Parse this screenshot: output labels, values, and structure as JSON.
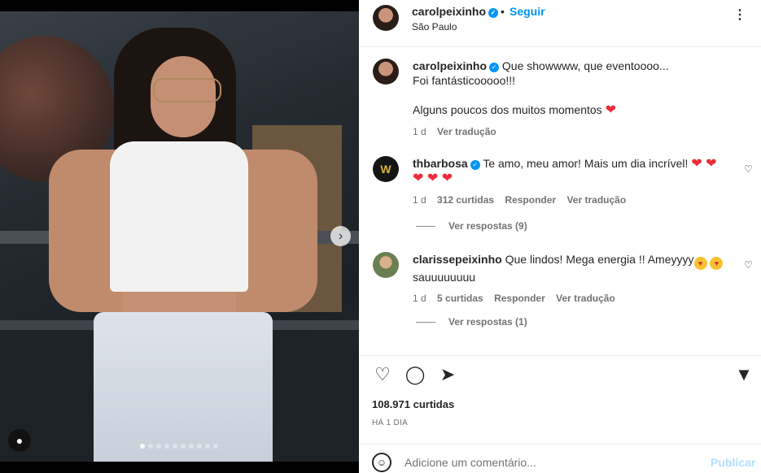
{
  "post": {
    "media": {
      "next_icon": "chevron-right-icon",
      "tag_icon": "user-tag-icon",
      "carousel_count": 10,
      "carousel_active": 0
    },
    "header": {
      "username": "carolpeixinho",
      "verified_icon": "verified-badge-icon",
      "separator": "•",
      "follow_label": "Seguir",
      "location": "São Paulo",
      "more_icon": "more-options-icon",
      "more_label": "⋮"
    },
    "caption": {
      "username": "carolpeixinho",
      "line1": "Que showwww, que eventoooo...",
      "line2": "Foi fantásticooooo!!!",
      "line3": "Alguns poucos dos muitos momentos",
      "heart": "❤",
      "time": "1 d",
      "translate": "Ver tradução"
    },
    "comments": [
      {
        "username": "thbarbosa",
        "verified": true,
        "text": "Te amo, meu amor! Mais um dia incrível!",
        "hearts_inline": "❤ ❤",
        "hearts_line2": "❤ ❤ ❤",
        "time": "1 d",
        "likes": "312 curtidas",
        "reply": "Responder",
        "translate": "Ver tradução",
        "view_replies": "Ver respostas (9)"
      },
      {
        "username": "clarissepeixinho",
        "verified": false,
        "text": "Que lindos! Mega energia !! Ameyyyy",
        "text_line2": "sauuuuuuuu",
        "emoji": "😍",
        "time": "1 d",
        "likes": "5 curtidas",
        "reply": "Responder",
        "translate": "Ver tradução",
        "view_replies": "Ver respostas (1)"
      }
    ],
    "actions": {
      "like_icon": "heart-outline-icon",
      "comment_icon": "comment-icon",
      "share_icon": "share-icon",
      "save_icon": "bookmark-icon"
    },
    "likes": "108.971 curtidas",
    "age": "HÁ 1 DIA",
    "add_comment": {
      "emoji_icon": "emoji-icon",
      "placeholder": "Adicione um comentário...",
      "publish": "Publicar"
    },
    "colors": {
      "accent": "#0095f6",
      "publish_disabled": "#b2dffc",
      "heart": "#ed2d3c",
      "muted_text": "#737373"
    }
  }
}
